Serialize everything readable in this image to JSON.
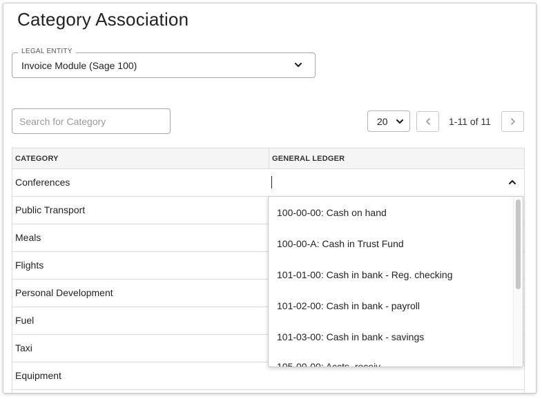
{
  "page": {
    "title": "Category Association"
  },
  "legal_entity": {
    "legend": "LEGAL ENTITY",
    "value": "Invoice Module (Sage 100)"
  },
  "search": {
    "placeholder": "Search for Category"
  },
  "pagination": {
    "page_size": "20",
    "range": "1-11 of 11"
  },
  "table": {
    "headers": {
      "category": "CATEGORY",
      "general_ledger": "GENERAL LEDGER"
    },
    "rows": [
      {
        "category": "Conferences"
      },
      {
        "category": "Public Transport"
      },
      {
        "category": "Meals"
      },
      {
        "category": "Flights"
      },
      {
        "category": "Personal Development"
      },
      {
        "category": "Fuel"
      },
      {
        "category": "Taxi"
      },
      {
        "category": "Equipment"
      }
    ]
  },
  "gl_dropdown": {
    "options": [
      "100-00-00: Cash on hand",
      "100-00-A: Cash in Trust Fund",
      "101-01-00: Cash in bank - Reg. checking",
      "101-02-00: Cash in bank - payroll",
      "101-03-00: Cash in bank - savings",
      "105-00-00: Accts. receiv"
    ]
  }
}
